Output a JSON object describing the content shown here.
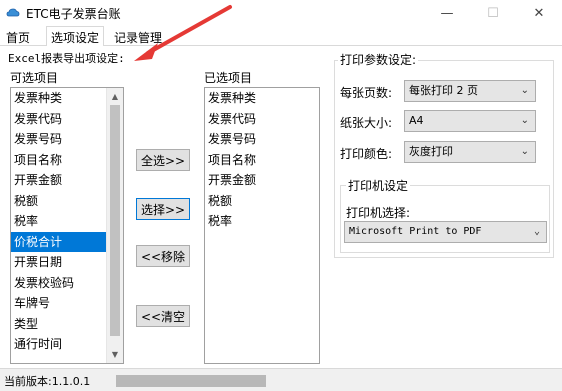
{
  "window": {
    "title": "ETC电子发票台账",
    "minimize_glyph": "—",
    "maximize_glyph": "☐",
    "close_glyph": "✕"
  },
  "tabs": [
    {
      "label": "首页"
    },
    {
      "label": "选项设定"
    },
    {
      "label": "记录管理"
    }
  ],
  "excel": {
    "heading": "Excel报表导出项设定:",
    "available_label": "可选项目",
    "selected_label": "已选项目",
    "available_items": [
      "发票种类",
      "发票代码",
      "发票号码",
      "项目名称",
      "开票金额",
      "税额",
      "税率",
      "价税合计",
      "开票日期",
      "发票校验码",
      "车牌号",
      "类型",
      "通行时间"
    ],
    "selected_index": 7,
    "selected_items": [
      "发票种类",
      "发票代码",
      "发票号码",
      "项目名称",
      "开票金额",
      "税额",
      "税率"
    ],
    "buttons": {
      "select_all": "全选>>",
      "select": "选择>>",
      "remove": "<<移除",
      "clear": "<<清空"
    }
  },
  "print": {
    "group_title": "打印参数设定:",
    "pages_label": "每张页数:",
    "pages_value": "每张打印 2 页",
    "paper_label": "纸张大小:",
    "paper_value": "A4",
    "color_label": "打印颜色:",
    "color_value": "灰度打印",
    "printer_group_title": "打印机设定",
    "printer_label": "打印机选择:",
    "printer_value": "Microsoft Print to PDF"
  },
  "status": {
    "version": "当前版本:1.1.0.1"
  },
  "icons": {
    "app": "cloud-app-icon",
    "dropdown": "chevron-down-icon",
    "annotation": "red-arrow-icon"
  },
  "colors": {
    "selection": "#0078d7",
    "annotation_arrow": "#e53935"
  }
}
